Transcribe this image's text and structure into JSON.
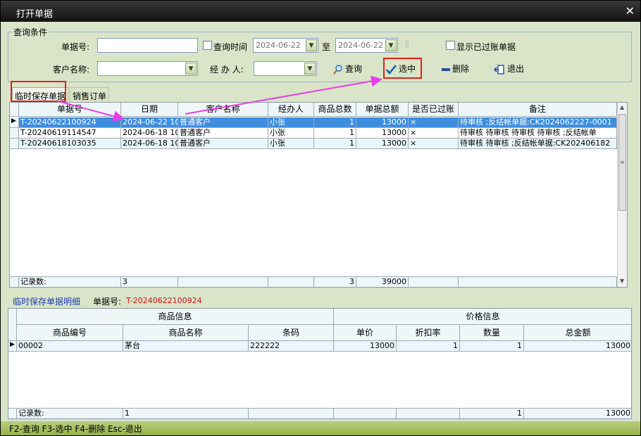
{
  "window": {
    "title": "打开单据"
  },
  "query": {
    "legend": "查询条件",
    "bill_no_label": "单据号:",
    "bill_no_value": "",
    "query_time_label": "查询时间",
    "date_from": "2024-06-22",
    "to_label": "至",
    "date_to": "2024-06-22",
    "show_closed_label": "显示已过账单据",
    "customer_label": "客户名称:",
    "customer_value": "",
    "handler_label": "经 办 人:",
    "handler_value": ""
  },
  "toolbar": {
    "query_label": "查询",
    "select_label": "选中",
    "delete_label": "删除",
    "exit_label": "退出"
  },
  "tabs": [
    {
      "label": "临时保存单据"
    },
    {
      "label": "销售订单"
    }
  ],
  "bills": {
    "headers": [
      "单据号",
      "日期",
      "客户名称",
      "经办人",
      "商品总数",
      "单据总额",
      "是否已过账",
      "备注"
    ],
    "rows": [
      {
        "no": "T-20240622100924",
        "date": "2024-06-22 10",
        "customer": "普通客户",
        "handler": "小张",
        "qty": "1",
        "amount": "13000",
        "posted": "×",
        "remark": "待审核 ;反结帐单据:CK2024062227-0001"
      },
      {
        "no": "T-20240619114547",
        "date": "2024-06-18 10",
        "customer": "普通客户",
        "handler": "小张",
        "qty": "1",
        "amount": "13000",
        "posted": "×",
        "remark": "待审核 待审核 待审核 待审核 ;反结帐单"
      },
      {
        "no": "T-20240618103035",
        "date": "2024-06-18 10",
        "customer": "普通客户",
        "handler": "小张",
        "qty": "1",
        "amount": "13000",
        "posted": "×",
        "remark": "待审核 待审核 ;反结帐单据:CK202406182"
      }
    ],
    "footer": {
      "label": "记录数:",
      "count": "3",
      "qty_total": "3",
      "amount_total": "39000"
    }
  },
  "detail": {
    "title": "临时保存单据明细",
    "bill_no_label": "单据号:",
    "bill_no_value": "T-20240622100924",
    "group_goods": "商品信息",
    "group_price": "价格信息",
    "headers": [
      "商品编号",
      "商品名称",
      "条码",
      "单价",
      "折扣率",
      "数量",
      "总金额"
    ],
    "rows": [
      {
        "code": "00002",
        "name": "茅台",
        "barcode": "222222",
        "price": "13000",
        "discount": "1",
        "qty": "1",
        "total": "13000"
      }
    ],
    "footer": {
      "label": "记录数:",
      "count": "1",
      "qty_total": "1",
      "amount_total": "13000"
    }
  },
  "statusbar": {
    "text": "F2-查询 F3-选中 F4-删除 Esc-退出"
  },
  "colors": {
    "accent_red": "#e52020",
    "arrow_magenta": "#e83ee8",
    "selected_row": "#3d8ee0",
    "status_bar": "#a8c060"
  }
}
